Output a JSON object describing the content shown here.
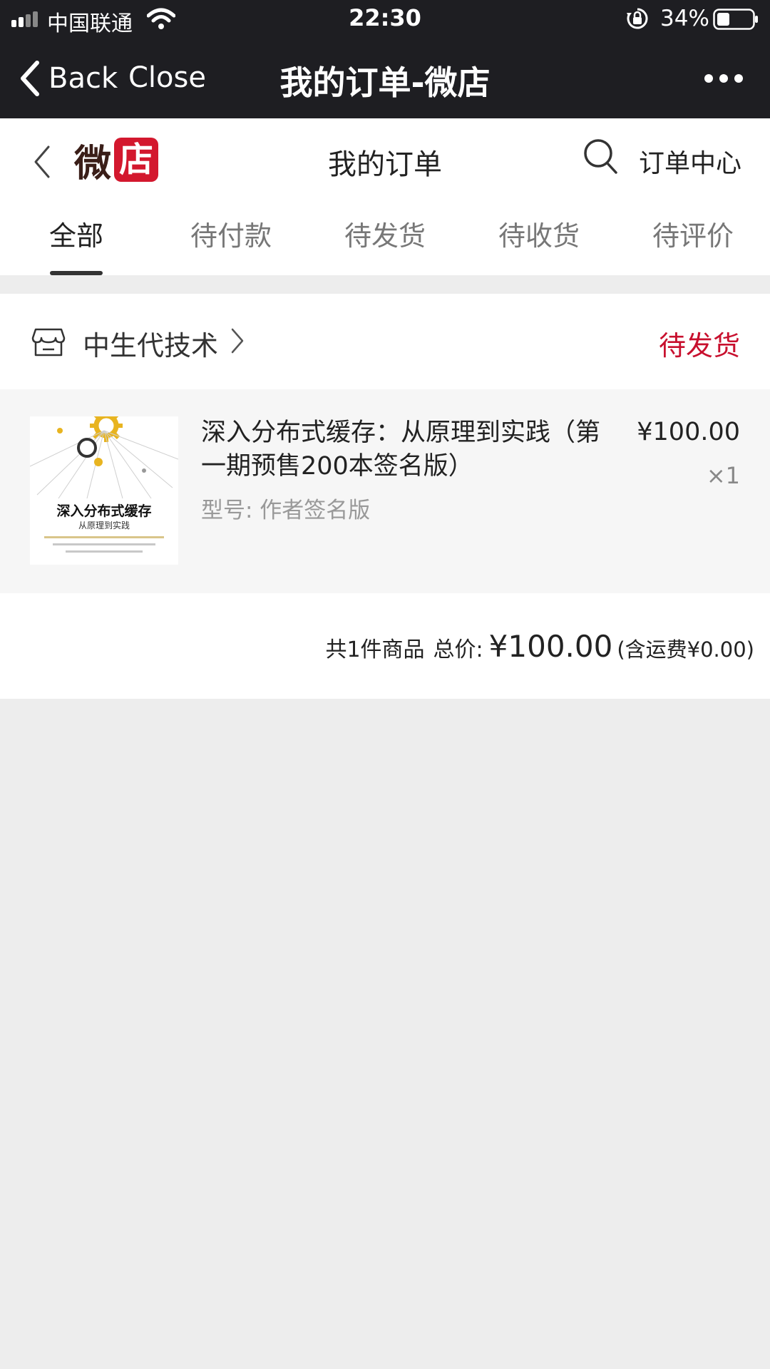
{
  "status_bar": {
    "carrier": "中国联通",
    "time": "22:30",
    "battery": "34%"
  },
  "nav": {
    "back_label": "Back",
    "close_label": "Close",
    "title": "我的订单-微店"
  },
  "header": {
    "logo_char_1": "微",
    "logo_char_2": "店",
    "title": "我的订单",
    "order_center": "订单中心"
  },
  "tabs": [
    {
      "label": "全部",
      "active": true
    },
    {
      "label": "待付款",
      "active": false
    },
    {
      "label": "待发货",
      "active": false
    },
    {
      "label": "待收货",
      "active": false
    },
    {
      "label": "待评价",
      "active": false
    }
  ],
  "order": {
    "shop_name": "中生代技术",
    "status": "待发货",
    "item": {
      "cover_title": "深入分布式缓存",
      "cover_subtitle": "从原理到实践",
      "title": "深入分布式缓存：从原理到实践（第一期预售200本签名版）",
      "price": "¥100.00",
      "quantity": "×1",
      "spec": "型号: 作者签名版"
    },
    "summary": {
      "count": "共1件商品",
      "total_label": "总价:",
      "total": "¥100.00",
      "shipping": "(含运费¥0.00)"
    }
  },
  "colors": {
    "top_bar": "#1e1e22",
    "accent_red": "#c8102e",
    "logo_red": "#d3182e",
    "page_bg": "#ededed"
  },
  "icons": [
    "signal-icon",
    "wifi-icon",
    "rotation-lock-icon",
    "battery-icon",
    "back-chevron-icon",
    "more-icon",
    "search-icon",
    "shop-icon",
    "chevron-right-icon",
    "gear-icon"
  ]
}
